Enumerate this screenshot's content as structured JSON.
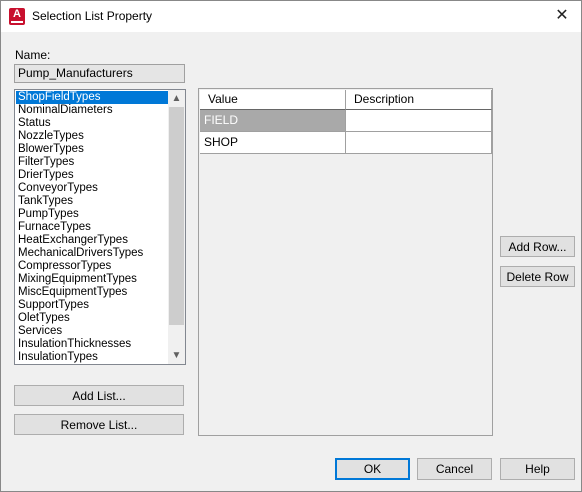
{
  "window": {
    "title": "Selection List Property",
    "close_glyph": "✕"
  },
  "name_field": {
    "label": "Name:",
    "value": "Pump_Manufacturers"
  },
  "list": {
    "items": [
      "ShopFieldTypes",
      "NominalDiameters",
      "Status",
      "NozzleTypes",
      "BlowerTypes",
      "FilterTypes",
      "DrierTypes",
      "ConveyorTypes",
      "TankTypes",
      "PumpTypes",
      "FurnaceTypes",
      "HeatExchangerTypes",
      "MechanicalDriversTypes",
      "CompressorTypes",
      "MixingEquipmentTypes",
      "MiscEquipmentTypes",
      "SupportTypes",
      "OletTypes",
      "Services",
      "InsulationThicknesses",
      "InsulationTypes"
    ],
    "selected_index": 0
  },
  "buttons": {
    "add_list": "Add List...",
    "remove_list": "Remove List...",
    "add_row": "Add Row...",
    "delete_row": "Delete Row",
    "ok": "OK",
    "cancel": "Cancel",
    "help": "Help"
  },
  "grid": {
    "columns": [
      "Value",
      "Description"
    ],
    "rows": [
      {
        "value": "FIELD",
        "description": ""
      },
      {
        "value": "SHOP",
        "description": ""
      }
    ],
    "selected_row": 0
  },
  "colors": {
    "accent": "#0078d7",
    "brand": "#c8102e",
    "selected_row": "#a9a9a9"
  }
}
